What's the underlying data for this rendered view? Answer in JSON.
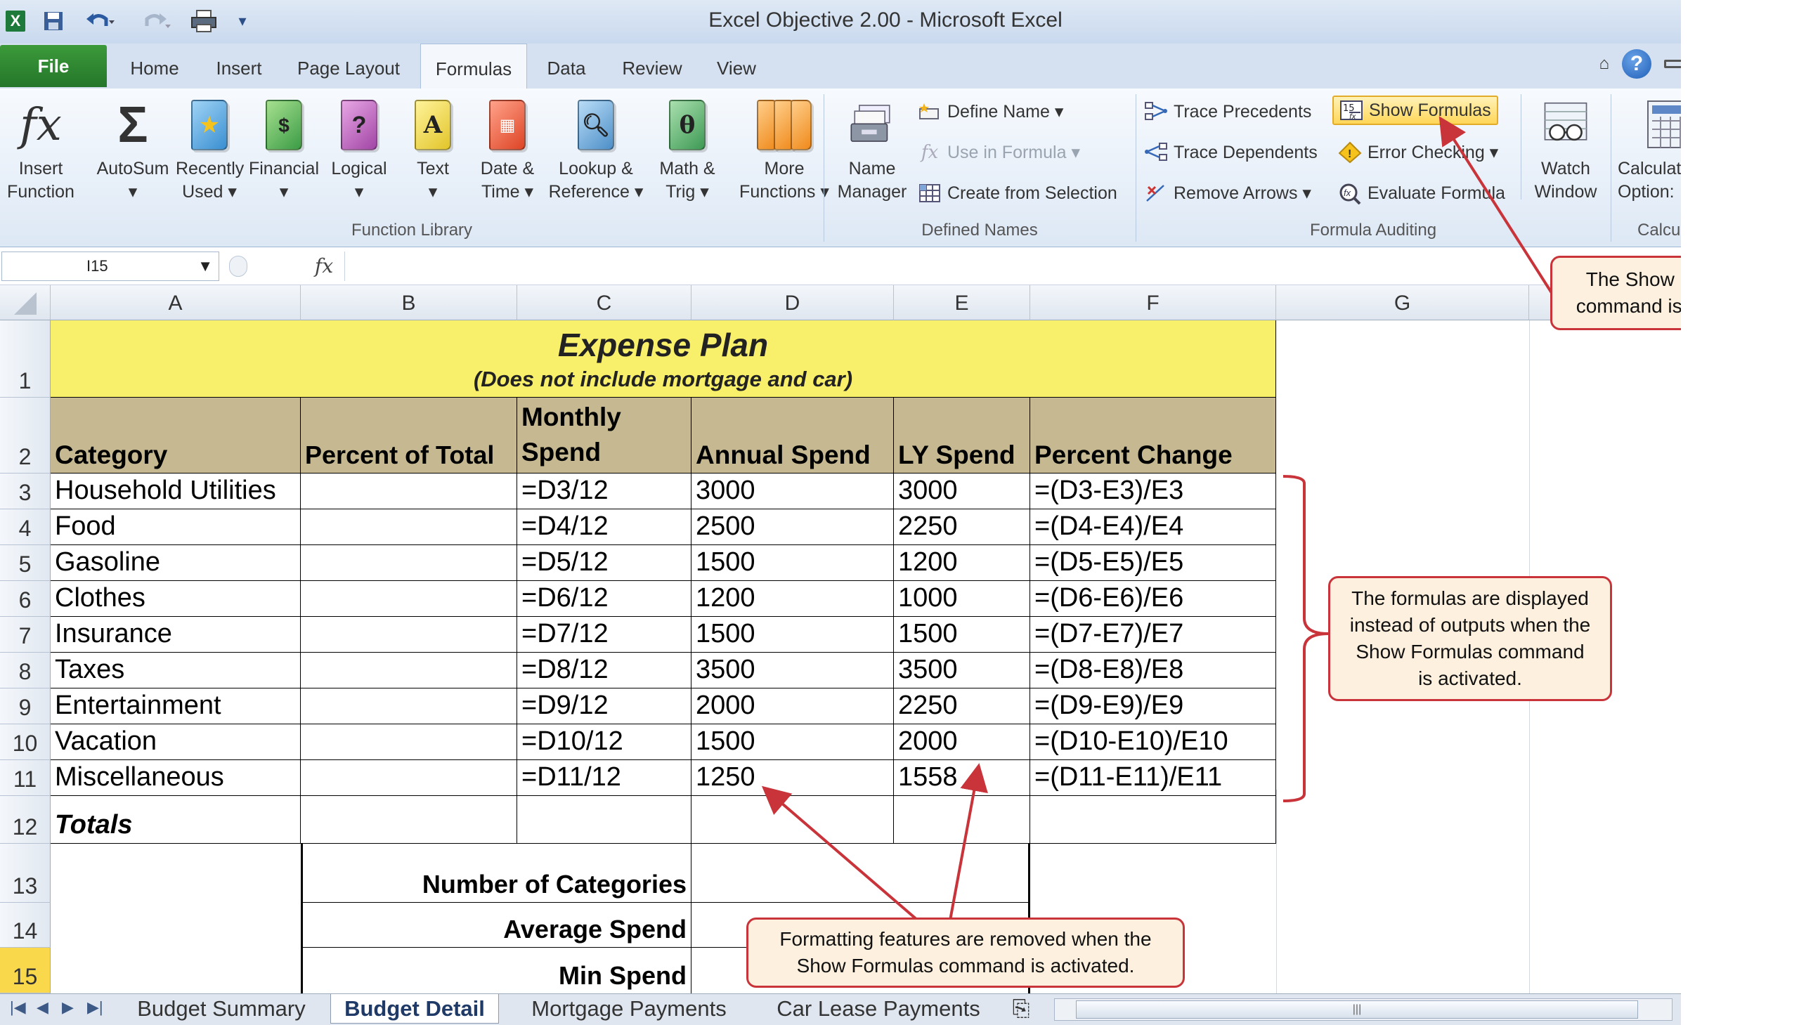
{
  "window": {
    "title": "Excel Objective 2.00 - Microsoft Excel"
  },
  "tabs": [
    "File",
    "Home",
    "Insert",
    "Page Layout",
    "Formulas",
    "Data",
    "Review",
    "View"
  ],
  "ribbon": {
    "function_library": {
      "label": "Function Library",
      "buttons": [
        {
          "line1": "Insert",
          "line2": "Function",
          "icon": "fx-icon"
        },
        {
          "line1": "AutoSum",
          "line2": "▾",
          "icon": "sigma-icon"
        },
        {
          "line1": "Recently",
          "line2": "Used ▾",
          "icon": "star-book-icon"
        },
        {
          "line1": "Financial",
          "line2": "▾",
          "icon": "financial-book-icon"
        },
        {
          "line1": "Logical",
          "line2": "▾",
          "icon": "logical-book-icon"
        },
        {
          "line1": "Text",
          "line2": "▾",
          "icon": "text-book-icon"
        },
        {
          "line1": "Date &",
          "line2": "Time ▾",
          "icon": "calendar-book-icon"
        },
        {
          "line1": "Lookup &",
          "line2": "Reference ▾",
          "icon": "lookup-book-icon"
        },
        {
          "line1": "Math &",
          "line2": "Trig ▾",
          "icon": "math-book-icon"
        },
        {
          "line1": "More",
          "line2": "Functions ▾",
          "icon": "more-books-icon"
        }
      ]
    },
    "defined_names": {
      "label": "Defined Names",
      "name_manager": {
        "line1": "Name",
        "line2": "Manager"
      },
      "define_name": "Define Name ▾",
      "use_in_formula": "Use in Formula ▾",
      "create_from_selection": "Create from Selection"
    },
    "formula_auditing": {
      "label": "Formula Auditing",
      "trace_precedents": "Trace Precedents",
      "trace_dependents": "Trace Dependents",
      "remove_arrows": "Remove Arrows ▾",
      "show_formulas": "Show Formulas",
      "error_checking": "Error Checking ▾",
      "evaluate_formula": "Evaluate Formula",
      "watch_window": {
        "line1": "Watch",
        "line2": "Window"
      }
    },
    "calculation": {
      "label": "Calcu",
      "line1": "Calculat",
      "line2": "Option:"
    }
  },
  "formula_bar": {
    "name_box": "I15",
    "fx": "fx",
    "value": ""
  },
  "columns": [
    "A",
    "B",
    "C",
    "D",
    "E",
    "F",
    "G"
  ],
  "rows": [
    "1",
    "2",
    "3",
    "4",
    "5",
    "6",
    "7",
    "8",
    "9",
    "10",
    "11",
    "12",
    "13",
    "14",
    "15"
  ],
  "sheet": {
    "title": "Expense Plan",
    "subtitle": "(Does not include mortgage and car)",
    "headers": [
      "Category",
      "Percent of Total",
      "Monthly",
      "Spend",
      "Annual Spend",
      "LY Spend",
      "Percent Change"
    ],
    "data": [
      {
        "cat": "Household Utilities",
        "monthly": "=D3/12",
        "annual": "3000",
        "ly": "3000",
        "change": "=(D3-E3)/E3"
      },
      {
        "cat": "Food",
        "monthly": "=D4/12",
        "annual": "2500",
        "ly": "2250",
        "change": "=(D4-E4)/E4"
      },
      {
        "cat": "Gasoline",
        "monthly": "=D5/12",
        "annual": "1500",
        "ly": "1200",
        "change": "=(D5-E5)/E5"
      },
      {
        "cat": "Clothes",
        "monthly": "=D6/12",
        "annual": "1200",
        "ly": "1000",
        "change": "=(D6-E6)/E6"
      },
      {
        "cat": "Insurance",
        "monthly": "=D7/12",
        "annual": "1500",
        "ly": "1500",
        "change": "=(D7-E7)/E7"
      },
      {
        "cat": "Taxes",
        "monthly": "=D8/12",
        "annual": "3500",
        "ly": "3500",
        "change": "=(D8-E8)/E8"
      },
      {
        "cat": "Entertainment",
        "monthly": "=D9/12",
        "annual": "2000",
        "ly": "2250",
        "change": "=(D9-E9)/E9"
      },
      {
        "cat": "Vacation",
        "monthly": "=D10/12",
        "annual": "1500",
        "ly": "2000",
        "change": "=(D10-E10)/E10"
      },
      {
        "cat": "Miscellaneous",
        "monthly": "=D11/12",
        "annual": "1250",
        "ly": "1558",
        "change": "=(D11-E11)/E11"
      }
    ],
    "totals": "Totals",
    "stats": [
      "Number of Categories",
      "Average Spend",
      "Min Spend"
    ]
  },
  "sheet_tabs": [
    "Budget Summary",
    "Budget Detail",
    "Mortgage Payments",
    "Car Lease Payments"
  ],
  "callouts": {
    "show_formulas": [
      "The Show Formulas",
      "command is activated."
    ],
    "formulas_displayed": [
      "The formulas are displayed",
      "instead of outputs when the",
      "Show Formulas command",
      "is activated."
    ],
    "formatting_removed": [
      "Formatting features are removed when the",
      "Show Formulas command is activated."
    ]
  },
  "colors": {
    "title_fill": "#f8ef6a",
    "header_fill": "#c6b991",
    "callout_border": "#c8343a",
    "callout_fill": "#fdf0de",
    "accent": "#2b4f86"
  }
}
